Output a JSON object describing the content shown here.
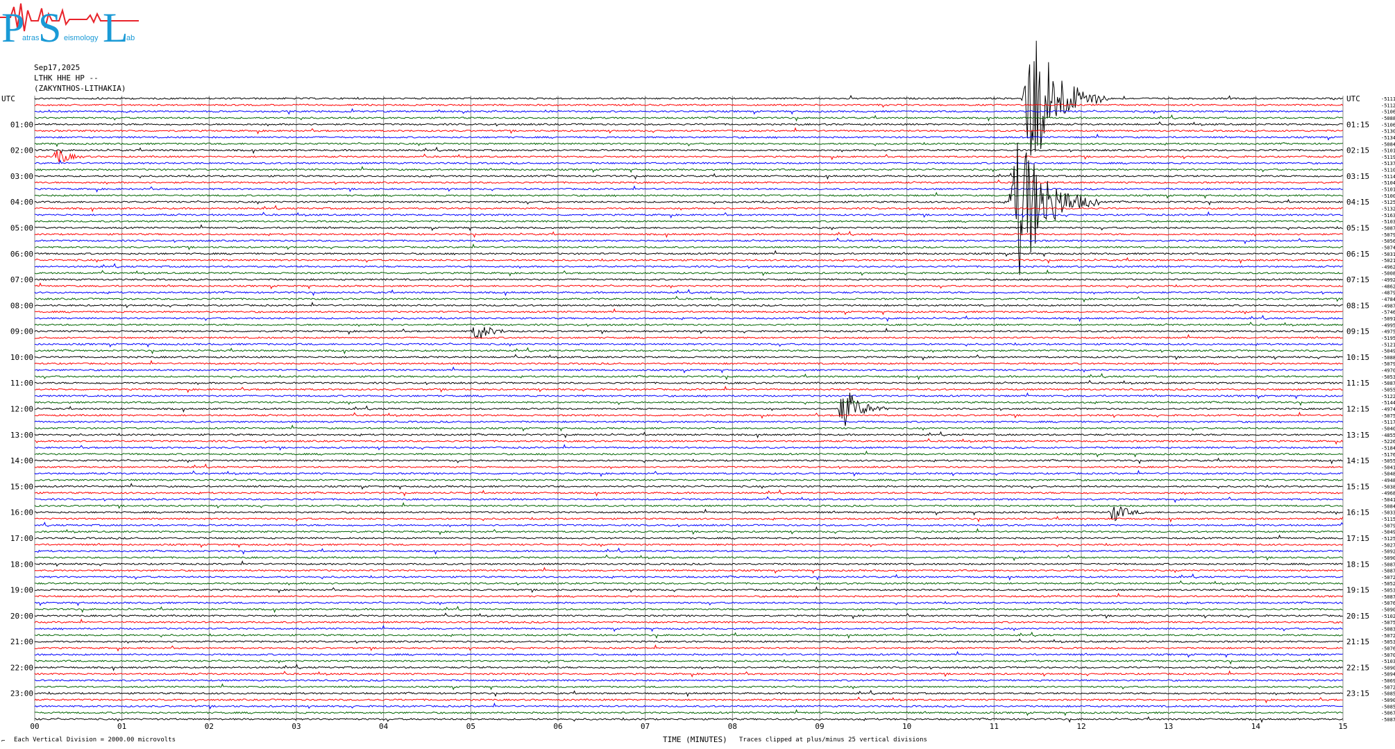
{
  "logo": {
    "letters": [
      "P",
      "S",
      "L"
    ],
    "words": [
      "atras",
      "eismology",
      "ab"
    ],
    "colors": {
      "blue": "#1a9ad6",
      "red": "#e8232a"
    }
  },
  "header": {
    "date": "Sep17,2025",
    "station": "LTHK HHE HP --",
    "location": "(ZAKYNTHOS-LITHAKIA)"
  },
  "footer": {
    "scale_note": "Each Vertical Division = 2000.00 microvolts",
    "clip_note": "Traces clipped at plus/minus 25 vertical divisions",
    "corner_mark": "⌐"
  },
  "chart_data": {
    "type": "line",
    "title": "",
    "xlabel": "TIME (MINUTES)",
    "ylabel": "",
    "x_ticks": [
      "00",
      "01",
      "02",
      "03",
      "04",
      "05",
      "06",
      "07",
      "08",
      "09",
      "10",
      "11",
      "12",
      "13",
      "14",
      "15"
    ],
    "xlim": [
      0,
      15
    ],
    "left_labels": [
      "UTC",
      "01:00",
      "02:00",
      "03:00",
      "04:00",
      "05:00",
      "06:00",
      "07:00",
      "08:00",
      "09:00",
      "10:00",
      "11:00",
      "12:00",
      "13:00",
      "14:00",
      "15:00",
      "16:00",
      "17:00",
      "18:00",
      "19:00",
      "20:00",
      "21:00",
      "22:00",
      "23:00"
    ],
    "right_labels": [
      "UTC",
      "01:15",
      "02:15",
      "03:15",
      "04:15",
      "05:15",
      "06:15",
      "07:15",
      "08:15",
      "09:15",
      "10:15",
      "11:15",
      "12:15",
      "13:15",
      "14:15",
      "15:15",
      "16:15",
      "17:15",
      "18:15",
      "19:15",
      "20:15",
      "21:15",
      "22:15",
      "23:15"
    ],
    "trace_colors": [
      "#000000",
      "#ff0000",
      "#0000ff",
      "#006400"
    ],
    "grid": true,
    "row_offsets": [
      -5111,
      -5112,
      -5106,
      -5088,
      -5106,
      -5130,
      -5134,
      -5084,
      -5101,
      -5119,
      -5137,
      -5110,
      -5114,
      -5104,
      -5101,
      -5100,
      -5125,
      -5132,
      -5163,
      -5103,
      -5087,
      -5079,
      -5056,
      -5074,
      -5031,
      -5021,
      -4962,
      -5008,
      -4992,
      -4862,
      -4879,
      -4784,
      -4987,
      -5746,
      -5091,
      -4995,
      -4975,
      -5195,
      -5121,
      -5049,
      -5088,
      -5079,
      -4970,
      -5053,
      -5087,
      -5055,
      -5122,
      -5144,
      -4974,
      -5075,
      -5117,
      -5040,
      -4855,
      -5226,
      -5184,
      -5176,
      -5055,
      -5041,
      -5048,
      -4948,
      -5038,
      -4968,
      -5041,
      -5084,
      -5033,
      -5115,
      -5079,
      -5049,
      -5125,
      -5027,
      -5092,
      -5090,
      -5087,
      -5087,
      -5072,
      -5052,
      -5053,
      -5087,
      -5076,
      -5090,
      -5102,
      -5075,
      -5083,
      -5072,
      -5053,
      -5076,
      -5070,
      -5103,
      -5090,
      -5094,
      -5069,
      -5072,
      -5085,
      -5090,
      -5085,
      -5067,
      -5087
    ],
    "events": [
      {
        "row": 0,
        "start_min": 11.3,
        "end_min": 12.3,
        "amplitude": "clipped"
      },
      {
        "row": 16,
        "start_min": 11.15,
        "end_min": 12.2,
        "amplitude": "clipped"
      },
      {
        "row": 9,
        "start_min": 0.2,
        "end_min": 0.6,
        "amplitude": "medium"
      },
      {
        "row": 36,
        "start_min": 5.0,
        "end_min": 5.5,
        "amplitude": "medium"
      },
      {
        "row": 48,
        "start_min": 9.2,
        "end_min": 9.8,
        "amplitude": "large"
      },
      {
        "row": 64,
        "start_min": 12.3,
        "end_min": 12.8,
        "amplitude": "medium"
      }
    ]
  }
}
